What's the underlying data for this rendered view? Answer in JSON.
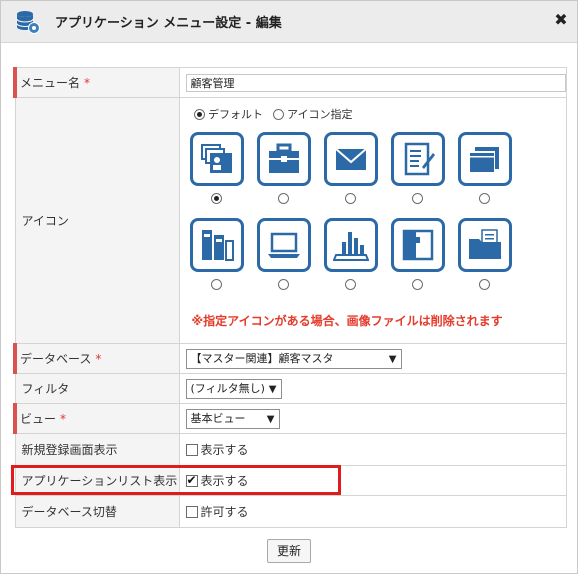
{
  "dialog": {
    "title": "アプリケーション メニュー設定 - 編集",
    "close_glyph": "✖"
  },
  "form": {
    "menu_name": {
      "label": "メニュー名",
      "required_mark": "*",
      "value": "顧客管理"
    },
    "icon": {
      "label": "アイコン",
      "option_default": "デフォルト",
      "option_custom": "アイコン指定",
      "selected_option": "デフォルト",
      "icons": [
        "contacts-icon",
        "toolbox-icon",
        "mail-icon",
        "document-edit-icon",
        "box-icon",
        "binder-icon",
        "laptop-icon",
        "bar-chart-icon",
        "book-icon",
        "folder-icon"
      ],
      "selected_icon_index": 0,
      "warning": "※指定アイコンがある場合、画像ファイルは削除されます"
    },
    "database": {
      "label": "データベース",
      "required_mark": "*",
      "value": "【マスター関連】顧客マスタ"
    },
    "filter": {
      "label": "フィルタ",
      "value": "(フィルタ無し)"
    },
    "view": {
      "label": "ビュー",
      "required_mark": "*",
      "value": "基本ビュー"
    },
    "new_record_screen": {
      "label": "新規登録画面表示",
      "checkbox_label": "表示する",
      "checked": false
    },
    "app_list": {
      "label": "アプリケーションリスト表示",
      "checkbox_label": "表示する",
      "checked": true
    },
    "db_switch": {
      "label": "データベース切替",
      "checkbox_label": "許可する",
      "checked": false
    }
  },
  "buttons": {
    "update": "更新"
  },
  "colors": {
    "accent": "#2b6aa6",
    "required": "#e0342f",
    "highlight": "#e11a1a"
  }
}
